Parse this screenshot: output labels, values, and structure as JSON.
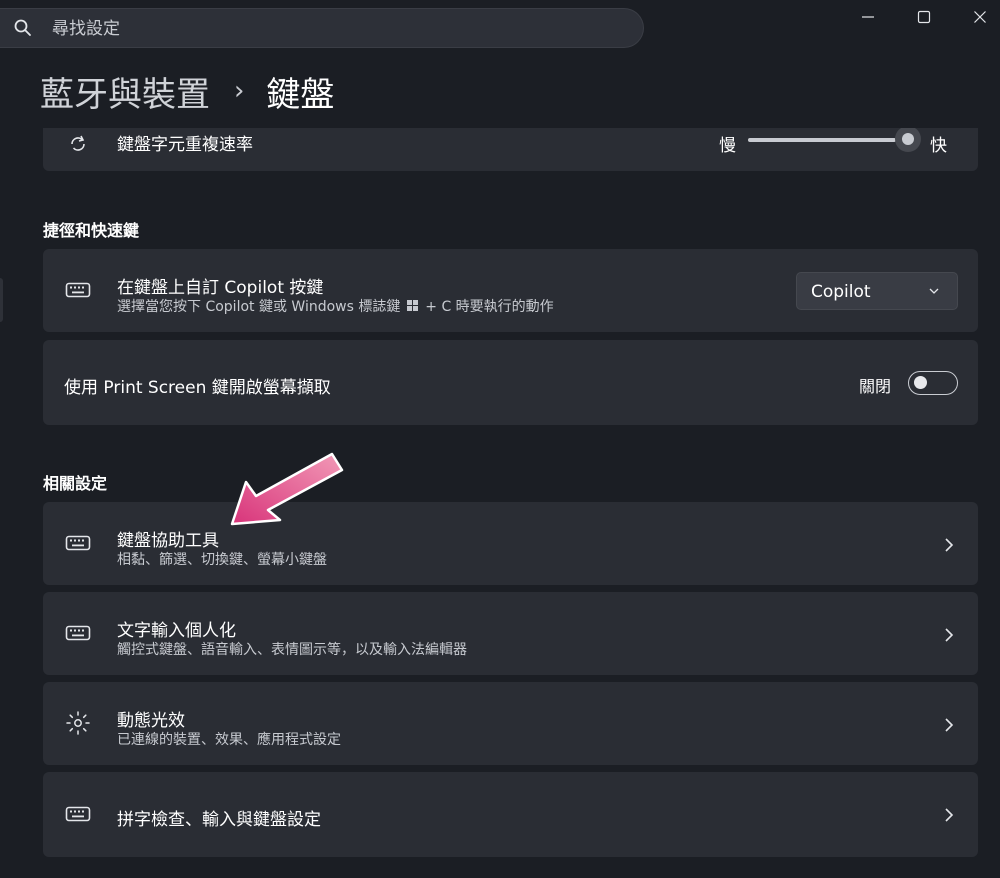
{
  "search": {
    "placeholder": "尋找設定"
  },
  "breadcrumb": {
    "root": "藍牙與裝置",
    "separator": "›",
    "current": "鍵盤"
  },
  "partial_row": {
    "label": "鍵盤字元重複速率",
    "slider_min_label": "慢",
    "slider_max_label": "快",
    "slider_value": 0.95
  },
  "shortcuts": {
    "heading": "捷徑和快速鍵",
    "copilot": {
      "title": "在鍵盤上自訂 Copilot 按鍵",
      "desc_before": "選擇當您按下 Copilot 鍵或 Windows 標誌鍵",
      "desc_after": "+ C 時要執行的動作",
      "dropdown_value": "Copilot"
    },
    "printscreen": {
      "title": "使用 Print Screen 鍵開啟螢幕擷取",
      "state_label": "關閉",
      "enabled": false
    }
  },
  "related": {
    "heading": "相關設定",
    "items": [
      {
        "title": "鍵盤協助工具",
        "desc": "相黏、篩選、切換鍵、螢幕小鍵盤",
        "icon": "keyboard-icon"
      },
      {
        "title": "文字輸入個人化",
        "desc": "觸控式鍵盤、語音輸入、表情圖示等，以及輸入法編輯器",
        "icon": "keyboard-icon"
      },
      {
        "title": "動態光效",
        "desc": "已連線的裝置、效果、應用程式設定",
        "icon": "sun-lighting-icon"
      },
      {
        "title": "拼字檢查、輸入與鍵盤設定",
        "desc": "",
        "icon": "keyboard-icon"
      }
    ]
  },
  "colors": {
    "background": "#1b1e24",
    "card": "#2a2d34",
    "annotation_arrow": "#e0467f"
  }
}
